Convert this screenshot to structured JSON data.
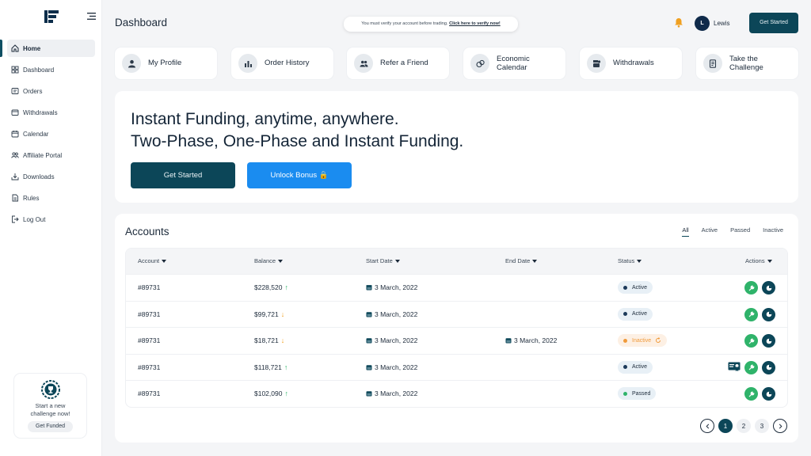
{
  "sidebar": {
    "items": [
      {
        "label": "Home",
        "icon": "home-icon"
      },
      {
        "label": "Dashboard",
        "icon": "grid-icon"
      },
      {
        "label": "Orders",
        "icon": "orders-icon"
      },
      {
        "label": "Withdrawals",
        "icon": "wallet-icon"
      },
      {
        "label": "Calendar",
        "icon": "calendar-icon"
      },
      {
        "label": "Affiliate Portal",
        "icon": "users-icon"
      },
      {
        "label": "Downloads",
        "icon": "download-icon"
      },
      {
        "label": "Rules",
        "icon": "document-icon"
      },
      {
        "label": "Log Out",
        "icon": "logout-icon"
      }
    ],
    "promo": {
      "line1": "Start a new",
      "line2": "challenge now!",
      "button": "Get Funded"
    }
  },
  "header": {
    "title": "Dashboard",
    "verify_text": "You must verify your account before trading.",
    "verify_link": "Click here to verify now!",
    "avatar_initial": "L",
    "username": "Lewis",
    "cta": "Get Started"
  },
  "quick_links": [
    {
      "label": "My Profile"
    },
    {
      "label": "Order History"
    },
    {
      "label": "Refer a Friend"
    },
    {
      "label": "Economic Calendar"
    },
    {
      "label": "Withdrawals"
    },
    {
      "label": "Take the Challenge"
    }
  ],
  "hero": {
    "line1": "Instant Funding, anytime, anywhere.",
    "line2": "Two-Phase, One-Phase and Instant Funding.",
    "btn_primary": "Get Started",
    "btn_secondary": "Unlock Bonus 🔒"
  },
  "accounts": {
    "title": "Accounts",
    "tabs": [
      "All",
      "Active",
      "Passed",
      "Inactive"
    ],
    "columns": [
      "Account",
      "Balance",
      "Start Date",
      "End Date",
      "Status",
      "Actions"
    ],
    "rows": [
      {
        "account": "#89731",
        "balance": "$228,520",
        "trend": "up",
        "start": "3 March, 2022",
        "end": "",
        "status": "Active"
      },
      {
        "account": "#89731",
        "balance": "$99,721",
        "trend": "down",
        "start": "3 March, 2022",
        "end": "",
        "status": "Active"
      },
      {
        "account": "#89731",
        "balance": "$18,721",
        "trend": "down",
        "start": "3 March, 2022",
        "end": "3 March, 2022",
        "status": "Inactive"
      },
      {
        "account": "#89731",
        "balance": "$118,721",
        "trend": "up",
        "start": "3 March, 2022",
        "end": "",
        "status": "Active"
      },
      {
        "account": "#89731",
        "balance": "$102,090",
        "trend": "up",
        "start": "3 March, 2022",
        "end": "",
        "status": "Passed"
      }
    ],
    "pages": [
      "1",
      "2",
      "3"
    ],
    "arrow_up": "↑",
    "arrow_down": "↓"
  },
  "colors": {
    "primary": "#0c4658",
    "accent": "#1a8cf0",
    "success": "#2fb36a",
    "warning": "#f09a3a"
  }
}
